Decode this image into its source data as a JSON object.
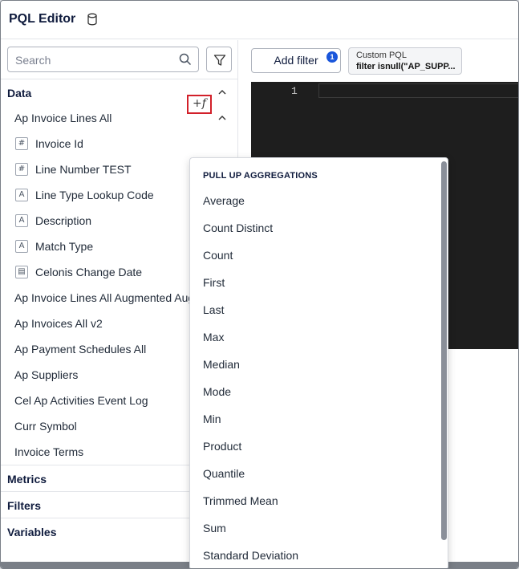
{
  "header": {
    "title": "PQL Editor",
    "db_icon": "database-icon"
  },
  "search": {
    "placeholder": "Search"
  },
  "sections": {
    "data": "Data",
    "metrics": "Metrics",
    "filters": "Filters",
    "variables": "Variables"
  },
  "table_group": {
    "name": "Ap Invoice Lines All",
    "fields": [
      {
        "label": "Invoice Id",
        "type_icon": "#"
      },
      {
        "label": "Line Number TEST",
        "type_icon": "#"
      },
      {
        "label": "Line Type Lookup Code",
        "type_icon": "A"
      },
      {
        "label": "Description",
        "type_icon": "A"
      },
      {
        "label": "Match Type",
        "type_icon": "A"
      },
      {
        "label": "Celonis Change Date",
        "type_icon": "▤"
      }
    ],
    "fx_label": "+f"
  },
  "tables": [
    "Ap Invoice Lines All Augmented Aug",
    "Ap Invoices All v2",
    "Ap Payment Schedules All",
    "Ap Suppliers",
    "Cel Ap Activities Event Log",
    "Curr Symbol",
    "Invoice Terms"
  ],
  "toolbar": {
    "add_filter": "Add filter",
    "filter_count": "1",
    "chip_title": "Custom PQL",
    "chip_value": "filter isnull(\"AP_SUPP..."
  },
  "editor": {
    "line_number": "1"
  },
  "aggregations": {
    "header": "PULL UP AGGREGATIONS",
    "items": [
      "Average",
      "Count Distinct",
      "Count",
      "First",
      "Last",
      "Max",
      "Median",
      "Mode",
      "Min",
      "Product",
      "Quantile",
      "Trimmed Mean",
      "Sum",
      "Standard Deviation"
    ]
  }
}
